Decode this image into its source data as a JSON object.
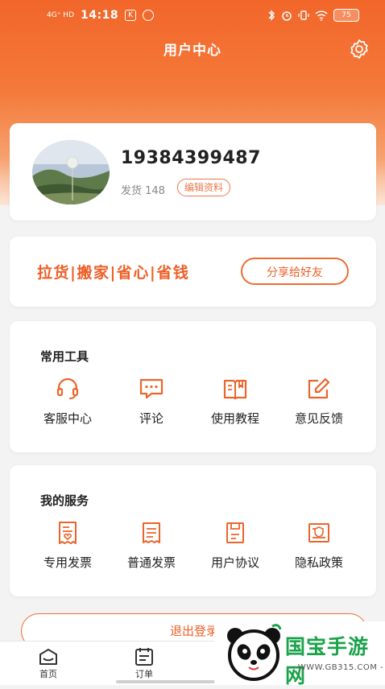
{
  "status_bar": {
    "network": "4G⁺ HD",
    "time": "14:18",
    "app_badge": "K",
    "battery": "75"
  },
  "header": {
    "title": "用户中心"
  },
  "profile": {
    "phone": "19384399487",
    "shipments_label": "发货 148",
    "edit_label": "编辑资料"
  },
  "promo": {
    "slogan": "拉货|搬家|省心|省钱",
    "share_label": "分享给好友"
  },
  "tools": {
    "title": "常用工具",
    "items": [
      {
        "label": "客服中心",
        "icon": "headset-icon"
      },
      {
        "label": "评论",
        "icon": "chat-bubble-icon"
      },
      {
        "label": "使用教程",
        "icon": "book-icon"
      },
      {
        "label": "意见反馈",
        "icon": "feedback-edit-icon"
      }
    ]
  },
  "services": {
    "title": "我的服务",
    "items": [
      {
        "label": "专用发票",
        "icon": "special-invoice-icon"
      },
      {
        "label": "普通发票",
        "icon": "invoice-icon"
      },
      {
        "label": "用户协议",
        "icon": "agreement-icon"
      },
      {
        "label": "隐私政策",
        "icon": "privacy-icon"
      }
    ]
  },
  "logout_label": "退出登录",
  "tabbar": {
    "items": [
      {
        "label": "首页",
        "icon": "home-icon"
      },
      {
        "label": "订单",
        "icon": "order-icon"
      }
    ]
  },
  "watermark": {
    "name": "国宝手游网",
    "url": "- WWW.GB315.COM -"
  },
  "colors": {
    "accent": "#ee5f27",
    "header": "#f2662a",
    "background": "#f3f3f3"
  }
}
